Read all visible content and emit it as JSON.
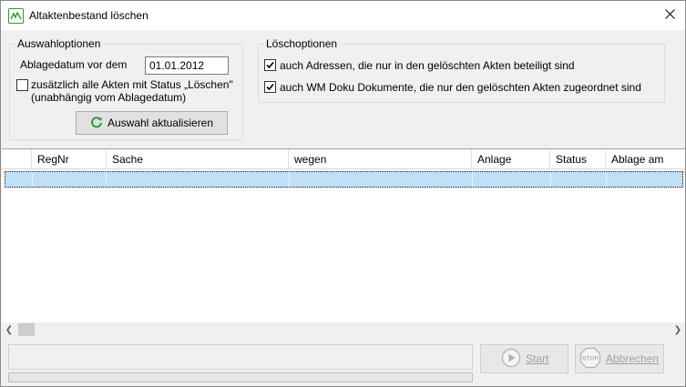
{
  "window": {
    "title": "Altaktenbestand löschen"
  },
  "auswahl": {
    "legend": "Auswahloptionen",
    "date_label": "Ablagedatum vor dem",
    "date_value": "01.01.2012",
    "status_cb_line1": "zusätzlich alle Akten mit Status „Löschen\"",
    "status_cb_line2": "(unabhängig vom Ablagedatum)",
    "status_cb_checked": false,
    "refresh_label": "Auswahl aktualisieren"
  },
  "loesch": {
    "legend": "Löschoptionen",
    "opt1_label": "auch Adressen, die nur in den gelöschten Akten beteiligt sind",
    "opt1_checked": true,
    "opt2_label": "auch WM Doku Dokumente, die nur den gelöschten Akten zugeordnet sind",
    "opt2_checked": true
  },
  "grid": {
    "columns": [
      "",
      "RegNr",
      "Sache",
      "wegen",
      "Anlage",
      "Status",
      "Ablage am"
    ],
    "rows": [
      [
        "",
        "",
        "",
        "",
        "",
        "",
        ""
      ]
    ]
  },
  "actions": {
    "start_label": "Start",
    "cancel_label": "Abbrechen"
  },
  "colors": {
    "accent_green": "#2e9a3e",
    "selection": "#bfe0f7"
  }
}
